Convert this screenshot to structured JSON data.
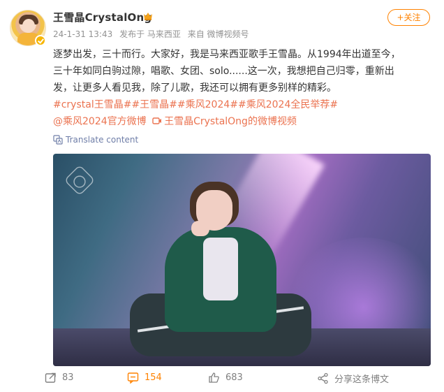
{
  "user": {
    "name": "王雪晶CrystalOng"
  },
  "meta": {
    "time": "24-1-31 13:43",
    "location": "发布于 马来西亚",
    "source": "来自 微博视频号"
  },
  "follow": {
    "label": "+关注"
  },
  "post": {
    "line1": "逐梦出发，三十而行。大家好，我是马来西亚歌手王雪晶。从1994年出道至今，",
    "line2": "三十年如同白驹过隙，唱歌、女团、solo......这一次，我想把自己归零，重新出",
    "line3": "发，让更多人看见我，除了儿歌，我还可以拥有更多别样的精彩。",
    "topics": "#crystal王雪晶##王雪晶##乘风2024##乘风2024全民举荐#",
    "mention": "@乘风2024官方微博",
    "video_link": "王雪晶CrystalOng的微博视频"
  },
  "translate": {
    "label": "Translate content"
  },
  "actions": {
    "share_count": "83",
    "comment_count": "154",
    "like_count": "683",
    "share_label": "分享这条博文"
  },
  "colors": {
    "accent": "#ff8200",
    "link": "#eb7350",
    "muted": "#939393"
  },
  "icons": {
    "verified": "verified-badge-icon",
    "crown": "crown-icon",
    "translate": "translate-icon",
    "repost": "repost-icon",
    "comment": "comment-icon",
    "like": "like-icon",
    "share": "share-icon",
    "video": "video-icon"
  }
}
